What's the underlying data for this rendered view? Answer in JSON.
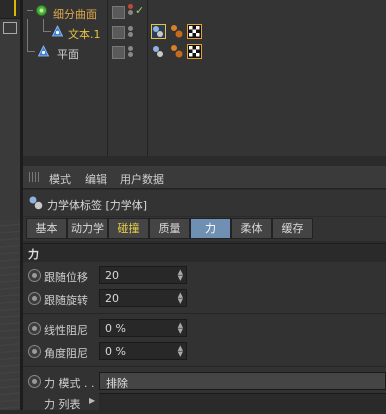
{
  "object_manager": {
    "objects": [
      {
        "name": "细分曲面",
        "color": "#e0a84a"
      },
      {
        "name": "文本.1",
        "color": "#e8c240"
      },
      {
        "name": "平面",
        "color": "#d0d0d0"
      }
    ]
  },
  "attribute_manager": {
    "menu": [
      "模式",
      "编辑",
      "用户数据"
    ],
    "title": "力学体标签 [力学体]",
    "tabs": [
      {
        "label": "基本",
        "state": "normal"
      },
      {
        "label": "动力学",
        "state": "normal"
      },
      {
        "label": "碰撞",
        "state": "highlight"
      },
      {
        "label": "质量",
        "state": "normal"
      },
      {
        "label": "力",
        "state": "active"
      },
      {
        "label": "柔体",
        "state": "normal"
      },
      {
        "label": "缓存",
        "state": "normal"
      }
    ],
    "section": "力",
    "params": {
      "follow_position": {
        "label": "跟随位移",
        "value": "20"
      },
      "follow_rotation": {
        "label": "跟随旋转",
        "value": "20"
      },
      "linear_damping": {
        "label": "线性阻尼",
        "value": "0 %"
      },
      "angular_damping": {
        "label": "角度阻尼",
        "value": "0 %"
      },
      "force_mode": {
        "label": "力 模式 . .",
        "value": "排除"
      },
      "force_list": {
        "label": "力 列表"
      }
    }
  },
  "colors": {
    "active_tab": "#6f8fb3",
    "highlight_tab_text": "#e9d24a",
    "check_green": "#9fd36a"
  }
}
